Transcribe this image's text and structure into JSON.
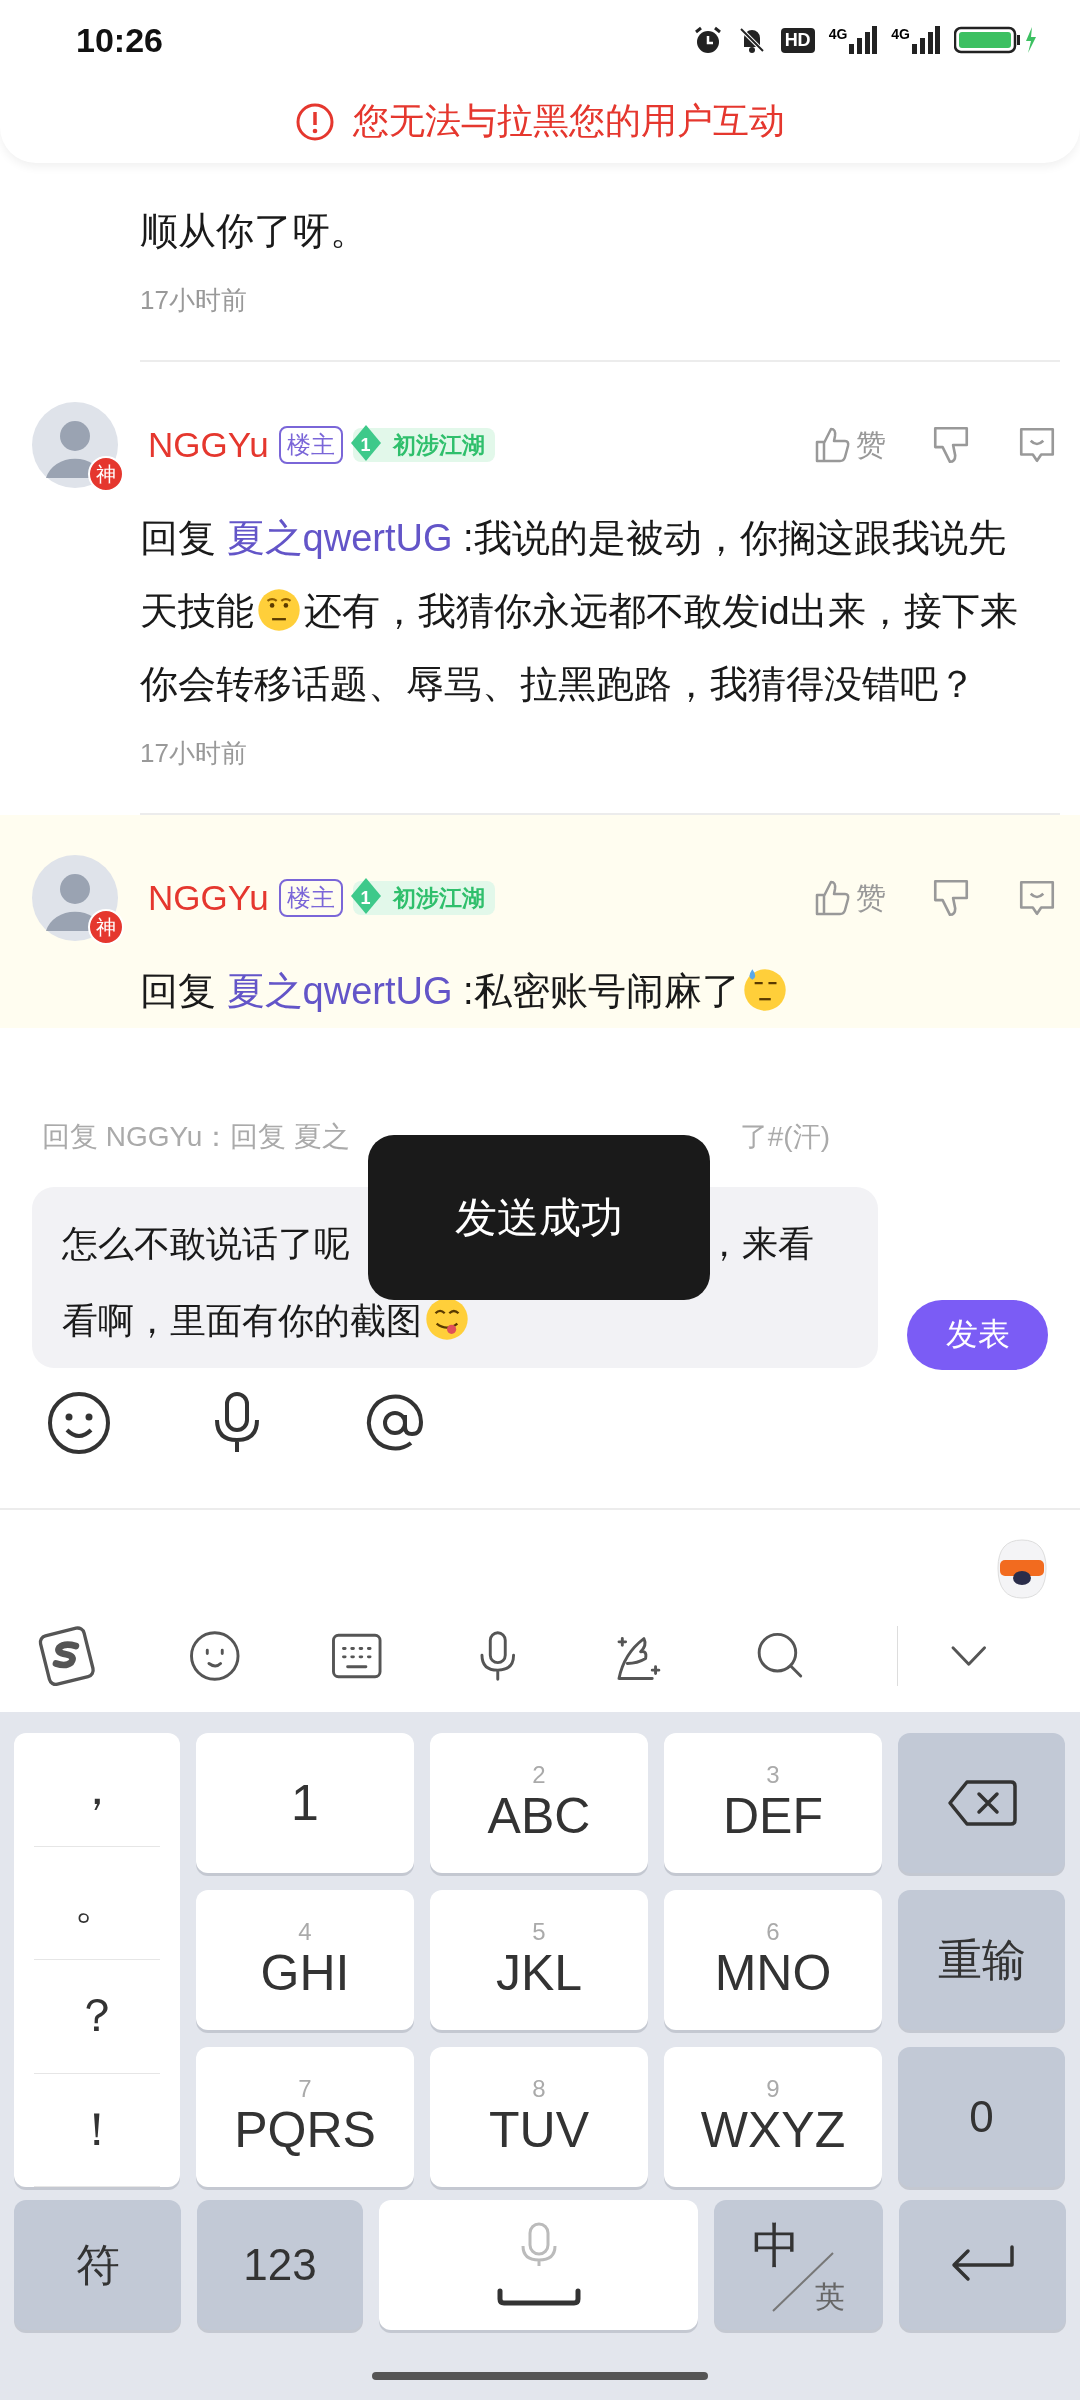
{
  "status_bar": {
    "time": "10:26",
    "hd_label": "HD",
    "network_labels": [
      "4G",
      "4G"
    ]
  },
  "banner": {
    "text": "您无法与拉黑您的用户互动"
  },
  "comments": [
    {
      "kind": "tail",
      "segments": [
        {
          "kind": "text",
          "text": "顺从你了呀。"
        }
      ],
      "time": "17小时前"
    },
    {
      "kind": "full",
      "highlighted": false,
      "author": "NGGYu",
      "owner_badge": "楼主",
      "level": "1",
      "level_title": "初涉江湖",
      "avatar_badge": "神",
      "like_label": "赞",
      "segments": [
        {
          "kind": "text",
          "text": "回复 "
        },
        {
          "kind": "mention",
          "text": "夏之qwertUG"
        },
        {
          "kind": "text",
          "text": " :我说的是被动，你搁这跟我说先天技能"
        },
        {
          "kind": "thinking"
        },
        {
          "kind": "text",
          "text": "还有，我猜你永远都不敢发id出来，接下来你会转移话题、辱骂、拉黑跑路，我猜得没错吧？"
        }
      ],
      "time": "17小时前"
    },
    {
      "kind": "full",
      "highlighted": true,
      "author": "NGGYu",
      "owner_badge": "楼主",
      "level": "1",
      "level_title": "初涉江湖",
      "avatar_badge": "神",
      "like_label": "赞",
      "segments": [
        {
          "kind": "text",
          "text": "回复 "
        },
        {
          "kind": "mention",
          "text": "夏之qwertUG"
        },
        {
          "kind": "text",
          "text": " :私密账号闹麻了"
        },
        {
          "kind": "sweat"
        }
      ]
    }
  ],
  "reply": {
    "quote": [
      "回复 NGGYu：回复 夏之",
      "了#(汗)"
    ],
    "value_lines": [
      [
        {
          "kind": "text",
          "text": "怎么不敢说话了呢"
        },
        {
          "kind": "text",
          "text": "，来看"
        }
      ],
      [
        {
          "kind": "text",
          "text": "看啊，里面有你的截图"
        },
        {
          "kind": "tongue"
        }
      ]
    ],
    "send_label": "发表"
  },
  "toast": {
    "text": "发送成功"
  },
  "keyboard": {
    "punctuation": [
      "，",
      "。",
      "？",
      "！"
    ],
    "keys": [
      {
        "kind": "digit",
        "label": "1"
      },
      {
        "kind": "letters",
        "number": "2",
        "label": "ABC"
      },
      {
        "kind": "letters",
        "number": "3",
        "label": "DEF"
      },
      {
        "kind": "delete"
      },
      {
        "kind": "letters",
        "number": "4",
        "label": "GHI"
      },
      {
        "kind": "letters",
        "number": "5",
        "label": "JKL"
      },
      {
        "kind": "letters",
        "number": "6",
        "label": "MNO"
      },
      {
        "kind": "action",
        "label": "重输"
      },
      {
        "kind": "letters",
        "number": "7",
        "label": "PQRS"
      },
      {
        "kind": "letters",
        "number": "8",
        "label": "TUV"
      },
      {
        "kind": "letters",
        "number": "9",
        "label": "WXYZ"
      },
      {
        "kind": "action",
        "label": "0"
      }
    ],
    "bottom": [
      {
        "kind": "action",
        "label": "符"
      },
      {
        "kind": "action",
        "label": "123"
      },
      {
        "kind": "space"
      },
      {
        "kind": "lang",
        "main": "中",
        "alt": "英"
      },
      {
        "kind": "enter"
      }
    ]
  }
}
